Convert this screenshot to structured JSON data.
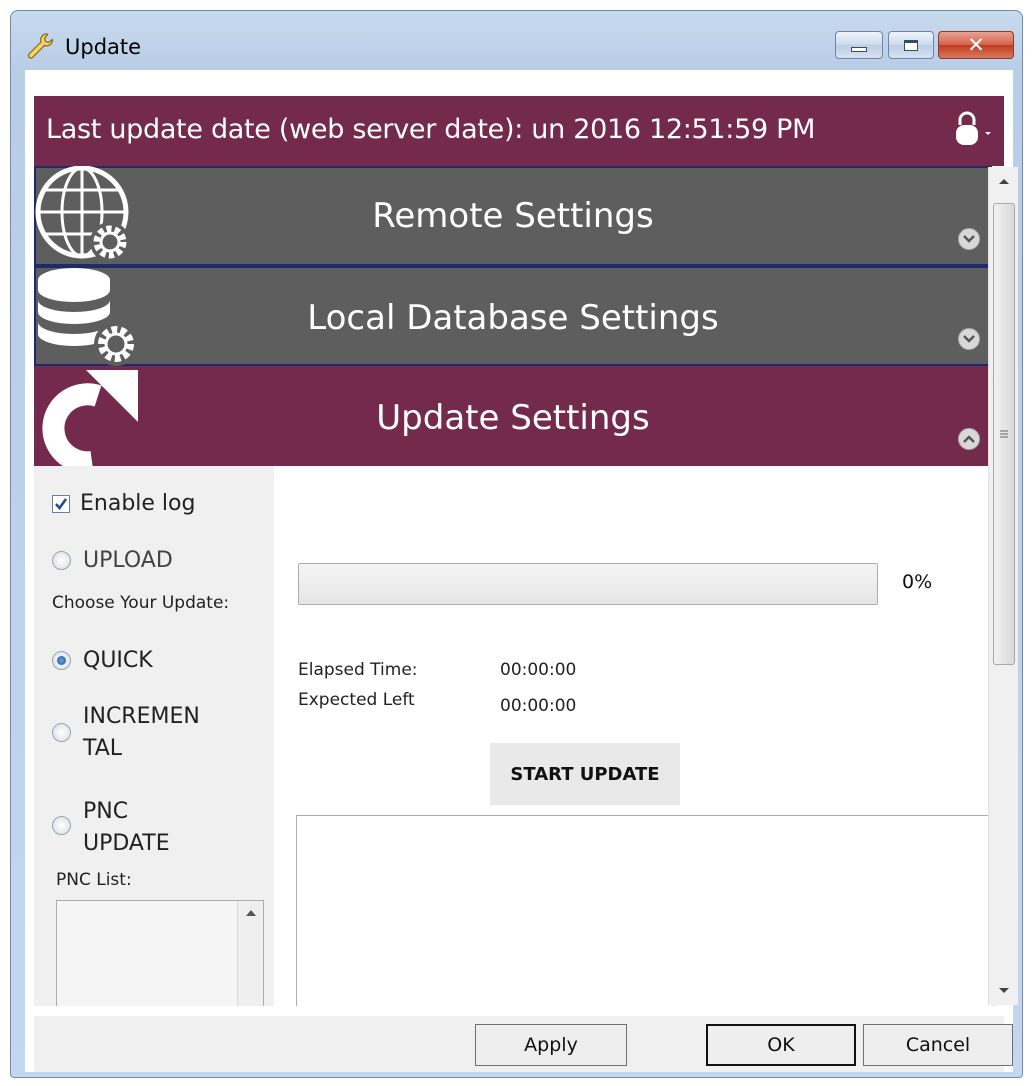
{
  "window": {
    "title": "Update"
  },
  "header": {
    "last_update": "Last update date (web server date): un 2016 12:51:59 PM"
  },
  "sections": {
    "remote": "Remote Settings",
    "local_db": "Local Database Settings",
    "update": "Update Settings"
  },
  "options": {
    "enable_log": "Enable log",
    "enable_log_checked": true,
    "upload": "UPLOAD",
    "choose_label": "Choose Your Update:",
    "quick": "QUICK",
    "incremental_line1": "INCREMEN",
    "incremental_line2": "TAL",
    "pnc_line1": "PNC",
    "pnc_line2": "UPDATE",
    "selected": "QUICK",
    "pnc_list_label": "PNC List:"
  },
  "progress": {
    "value_percent": 0,
    "label": "0%"
  },
  "timing": {
    "elapsed_label": "Elapsed Time:",
    "elapsed_value": "00:00:00",
    "expected_label": "Expected Left",
    "expected_value": "00:00:00"
  },
  "actions": {
    "start": "START UPDATE"
  },
  "footer": {
    "apply": "Apply",
    "ok": "OK",
    "cancel": "Cancel"
  },
  "colors": {
    "accent": "#742a4d",
    "section_gray": "#5e5e5e",
    "section_border": "#1f2a6a"
  },
  "icons": [
    "wrench-icon",
    "lock-icon",
    "globe-gear-icon",
    "database-gear-icon",
    "refresh-icon",
    "chevron-down-icon",
    "chevron-up-icon"
  ]
}
